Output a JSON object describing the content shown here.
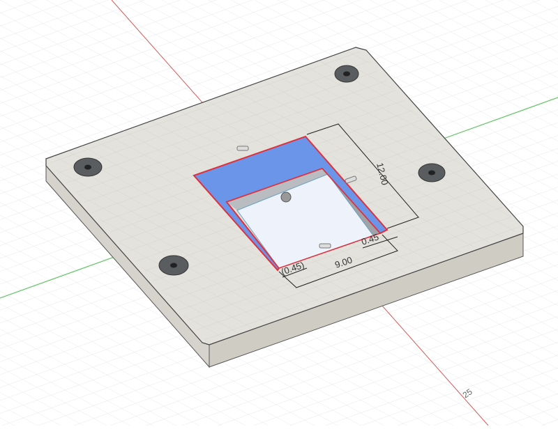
{
  "viewport": {
    "axis_label": "25",
    "colors": {
      "background": "#ffffff",
      "grid": "#e3e6ea",
      "x_axis": "#d45a5a",
      "y_axis": "#4fbf4f",
      "plate_top": "#e4e2dc",
      "plate_side": "#cfccc4",
      "selected_face": "#6b95e8",
      "selection_edge": "#e0303c",
      "hole_wall": "#b9bdc2"
    }
  },
  "dimensions": {
    "height": "12.00",
    "width": "9.00",
    "right_offset": "0.45",
    "left_offset": "(0.45)"
  }
}
